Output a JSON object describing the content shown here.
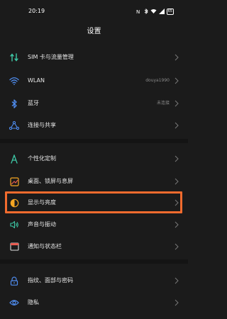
{
  "status_bar": {
    "time": "20:19",
    "battery": "65"
  },
  "header": {
    "title": "设置"
  },
  "groups": [
    {
      "items": [
        {
          "label": "SIM 卡与流量管理",
          "value": "",
          "icon": "sim-traffic-icon"
        },
        {
          "label": "WLAN",
          "value": "douya1990",
          "icon": "wifi-icon"
        },
        {
          "label": "蓝牙",
          "value": "未连接",
          "icon": "bluetooth-icon"
        },
        {
          "label": "连接与共享",
          "value": "",
          "icon": "connection-share-icon"
        }
      ]
    },
    {
      "items": [
        {
          "label": "个性化定制",
          "value": "",
          "icon": "personalize-icon"
        },
        {
          "label": "桌面、锁屏与息屏",
          "value": "",
          "icon": "desktop-lockscreen-icon"
        },
        {
          "label": "显示与亮度",
          "value": "",
          "icon": "display-brightness-icon"
        },
        {
          "label": "声音与振动",
          "value": "",
          "icon": "sound-vibration-icon"
        },
        {
          "label": "通知与状态栏",
          "value": "",
          "icon": "notification-statusbar-icon"
        }
      ]
    },
    {
      "items": [
        {
          "label": "指纹、面部与密码",
          "value": "",
          "icon": "fingerprint-lock-icon"
        },
        {
          "label": "隐私",
          "value": "",
          "icon": "privacy-icon"
        }
      ]
    }
  ],
  "colors": {
    "background": "#1b1b1b",
    "highlight": "#f26b2e",
    "sim": "#3ec9a7",
    "wifi": "#4f8df0",
    "bluetooth": "#4f8df0",
    "connection": "#4f8df0",
    "personalize": "#3ec9a7",
    "desktop": "#f5a623",
    "display": "#f5a623",
    "sound": "#3ec9a7",
    "notification": "#e85a4f",
    "fingerprint": "#4f8df0",
    "privacy": "#4f8df0"
  }
}
